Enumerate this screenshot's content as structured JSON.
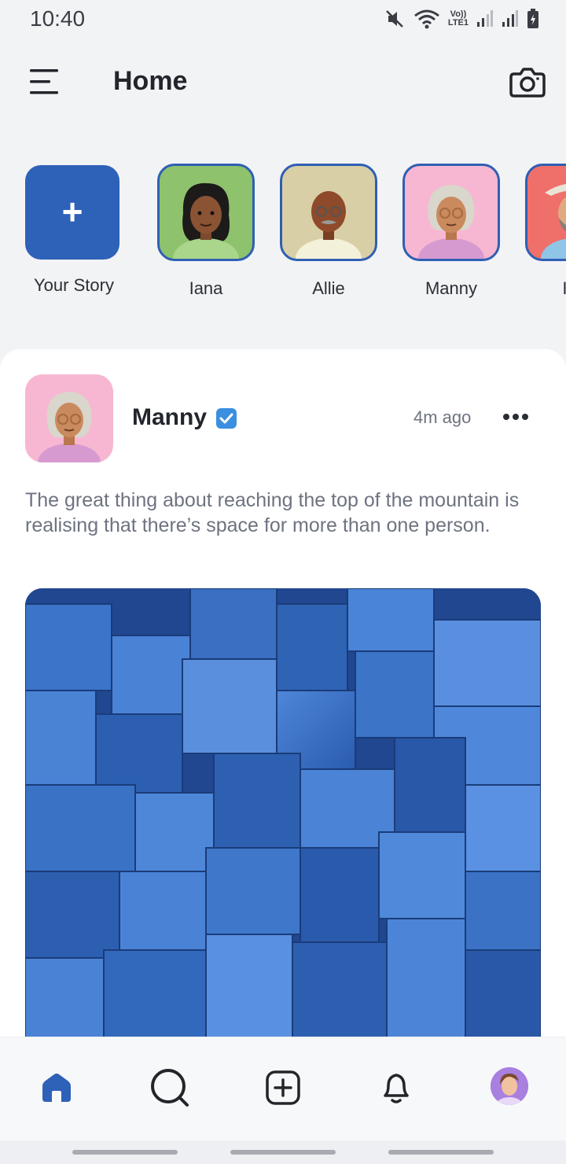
{
  "status_bar": {
    "time": "10:40",
    "lte_top": "Vo))",
    "lte_bottom": "LTE1",
    "icons": [
      "mute-icon",
      "wifi-icon",
      "signal-icon",
      "signal-icon",
      "battery-icon"
    ]
  },
  "header": {
    "title": "Home",
    "menu_icon": "menu-icon",
    "camera_icon": "camera-icon"
  },
  "stories": {
    "your_story_label": "Your Story",
    "items": [
      {
        "label": "Iana",
        "bg": "#8ec26c"
      },
      {
        "label": "Allie",
        "bg": "#d9cfa6"
      },
      {
        "label": "Manny",
        "bg": "#f7b7d2"
      },
      {
        "label": "Isa",
        "bg": "#ef6f6a"
      }
    ]
  },
  "post": {
    "author": "Manny",
    "verified": true,
    "time": "4m ago",
    "text": "The great thing about reaching the top of the mountain is realising that there’s space for more than one person."
  },
  "bottom_nav": {
    "items": [
      "home-icon",
      "search-icon",
      "add-post-icon",
      "notifications-icon",
      "profile-avatar"
    ]
  },
  "colors": {
    "accent": "#2e61b8",
    "verified": "#3b8fe0",
    "text_muted": "#6d7380",
    "background": "#f2f3f5"
  }
}
